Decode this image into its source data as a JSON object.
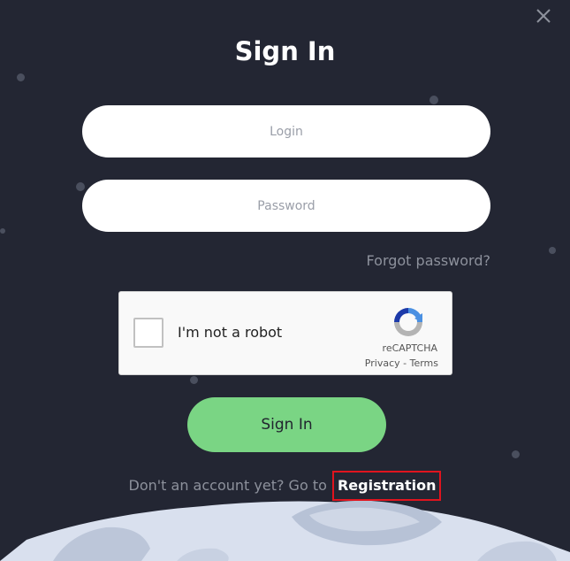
{
  "modal": {
    "title": "Sign In",
    "close_icon": "close-icon"
  },
  "form": {
    "login_placeholder": "Login",
    "password_placeholder": "Password",
    "forgot_password": "Forgot password?",
    "submit_label": "Sign In"
  },
  "captcha": {
    "label": "I'm not a robot",
    "brand": "reCAPTCHA",
    "privacy": "Privacy",
    "separator": " - ",
    "terms": "Terms",
    "logo_icon": "recaptcha-icon"
  },
  "footer": {
    "prompt": "Don't an account yet? Go to",
    "registration_link": "Registration"
  },
  "colors": {
    "background": "#232633",
    "accent": "#7ad584",
    "highlight": "#e0141e"
  }
}
